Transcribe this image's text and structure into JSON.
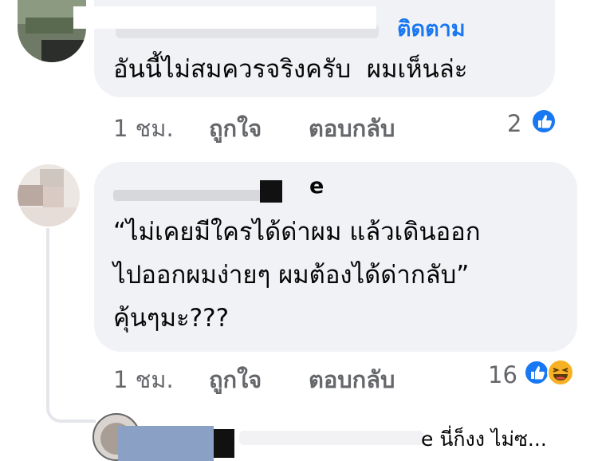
{
  "comments": [
    {
      "follow_label": "ติดตาม",
      "text_lines": [
        "อันนี้ไม่สมควรจริงครับ  ผมเห็นล่ะ"
      ],
      "time": "1 ชม.",
      "like_label": "ถูกใจ",
      "reply_label": "ตอบกลับ",
      "reaction_count": "2",
      "reactions": [
        "like-icon"
      ]
    },
    {
      "author_partial": "e",
      "text_lines": [
        "“ไม่เคยมีใครได้ด่าผม แล้วเดินออก",
        "ไปออกผมง่ายๆ ผมต้องได้ด่ากลับ”",
        "คุ้นๆมะ???"
      ],
      "time": "1 ชม.",
      "like_label": "ถูกใจ",
      "reply_label": "ตอบกลับ",
      "reaction_count": "16",
      "reactions": [
        "like-icon",
        "haha-icon"
      ]
    }
  ],
  "reply_preview": {
    "text": "e นี่ก็งง ไม่ซ..."
  },
  "colors": {
    "bubble": "#f0f2f5",
    "link": "#1877f2",
    "meta": "#65676b",
    "like": "#1877f2",
    "haha": "#f7b125"
  }
}
